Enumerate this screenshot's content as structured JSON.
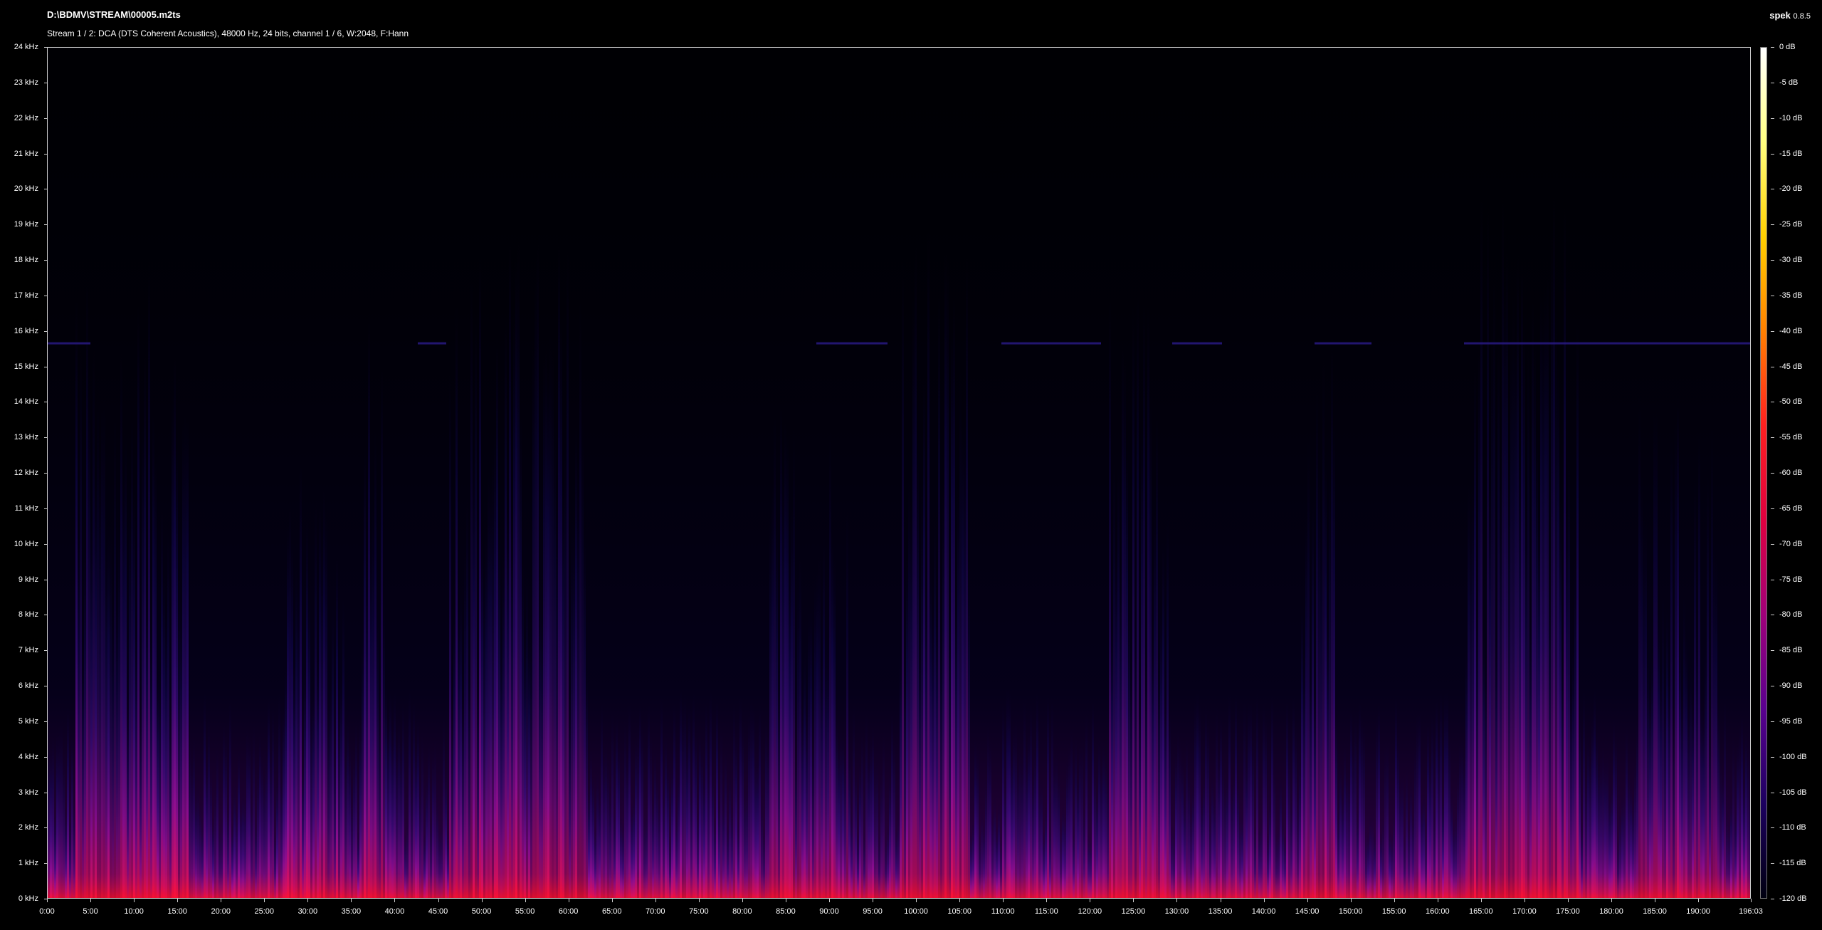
{
  "header": {
    "file_path": "D:\\BDMV\\STREAM\\00005.m2ts",
    "stream_info": "Stream 1 / 2: DCA (DTS Coherent Acoustics), 48000 Hz, 24 bits, channel 1 / 6, W:2048, F:Hann",
    "app_name": "spek",
    "app_version": "0.8.5"
  },
  "freq_axis": {
    "labels": [
      "0 kHz",
      "1 kHz",
      "2 kHz",
      "3 kHz",
      "4 kHz",
      "5 kHz",
      "6 kHz",
      "7 kHz",
      "8 kHz",
      "9 kHz",
      "10 kHz",
      "11 kHz",
      "12 kHz",
      "13 kHz",
      "14 kHz",
      "15 kHz",
      "16 kHz",
      "17 kHz",
      "18 kHz",
      "19 kHz",
      "20 kHz",
      "21 kHz",
      "22 kHz",
      "23 kHz",
      "24 kHz"
    ],
    "max_khz": 24
  },
  "time_axis": {
    "labels": [
      "0:00",
      "5:00",
      "10:00",
      "15:00",
      "20:00",
      "25:00",
      "30:00",
      "35:00",
      "40:00",
      "45:00",
      "50:00",
      "55:00",
      "60:00",
      "65:00",
      "70:00",
      "75:00",
      "80:00",
      "85:00",
      "90:00",
      "95:00",
      "100:00",
      "105:00",
      "110:00",
      "115:00",
      "120:00",
      "125:00",
      "130:00",
      "135:00",
      "140:00",
      "145:00",
      "150:00",
      "155:00",
      "160:00",
      "165:00",
      "170:00",
      "175:00",
      "180:00",
      "185:00",
      "190:00",
      "196:03"
    ],
    "tick_minutes": [
      0,
      5,
      10,
      15,
      20,
      25,
      30,
      35,
      40,
      45,
      50,
      55,
      60,
      65,
      70,
      75,
      80,
      85,
      90,
      95,
      100,
      105,
      110,
      115,
      120,
      125,
      130,
      135,
      140,
      145,
      150,
      155,
      160,
      165,
      170,
      175,
      180,
      185,
      190,
      196.05
    ],
    "total_minutes": 196.05
  },
  "colorbar": {
    "labels": [
      "0 dB",
      "-5 dB",
      "-10 dB",
      "-15 dB",
      "-20 dB",
      "-25 dB",
      "-30 dB",
      "-35 dB",
      "-40 dB",
      "-45 dB",
      "-50 dB",
      "-55 dB",
      "-60 dB",
      "-65 dB",
      "-70 dB",
      "-75 dB",
      "-80 dB",
      "-85 dB",
      "-90 dB",
      "-95 dB",
      "-100 dB",
      "-105 dB",
      "-110 dB",
      "-115 dB",
      "-120 dB"
    ],
    "colors": [
      "#ffffff",
      "#ffff80",
      "#ffd000",
      "#ff8000",
      "#ff2020",
      "#e00040",
      "#a0007a",
      "#5a0090",
      "#1c0060",
      "#000010"
    ]
  }
}
